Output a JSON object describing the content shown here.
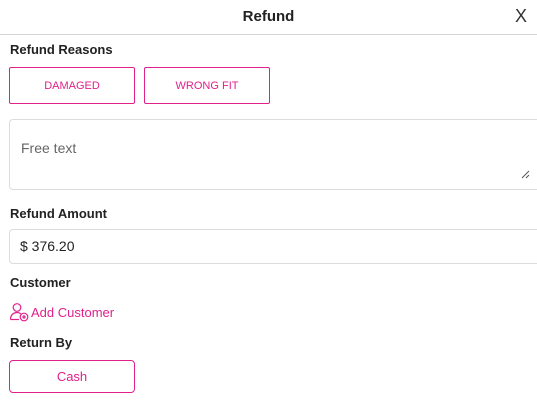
{
  "header": {
    "title": "Refund",
    "close_label": "X"
  },
  "reasons": {
    "label": "Refund Reasons",
    "options": [
      "DAMAGED",
      "WRONG FIT"
    ],
    "free_text_placeholder": "Free text"
  },
  "amount": {
    "label": "Refund Amount",
    "value": "$ 376.20"
  },
  "customer": {
    "label": "Customer",
    "add_label": "Add Customer"
  },
  "return_by": {
    "label": "Return By",
    "option": "Cash"
  },
  "colors": {
    "accent": "#e0218a",
    "border": "#dcdcdc",
    "text": "#222222"
  }
}
